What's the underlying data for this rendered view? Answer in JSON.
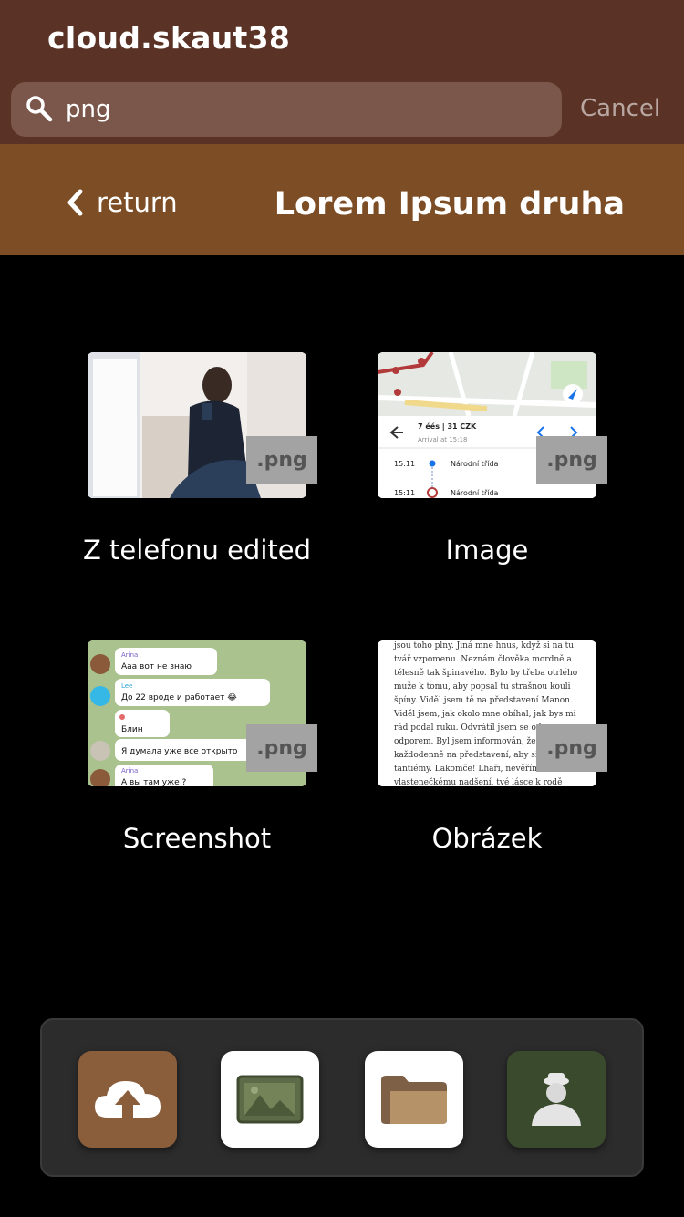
{
  "app": {
    "title": "cloud.skaut38"
  },
  "search": {
    "value": "png",
    "cancel_label": "Cancel"
  },
  "nav": {
    "back_label": "return",
    "folder_title": "Lorem Ipsum druha"
  },
  "files": [
    {
      "name": "Z telefonu edited",
      "ext": ".png"
    },
    {
      "name": "Image",
      "ext": ".png"
    },
    {
      "name": "Screenshot",
      "ext": ".png"
    },
    {
      "name": "Obrázek",
      "ext": ".png"
    }
  ],
  "thumb_text": {
    "map": {
      "line1": "7 éés | 31 CZK",
      "line2": "Arrival at 15:18",
      "stop_time_1": "15:11",
      "stop_name_1": "Národní třída",
      "stop_time_2": "15:11",
      "stop_name_2": "Národní třída"
    },
    "chat": [
      {
        "sender": "Arina",
        "text": "Ааа вот не знаю"
      },
      {
        "sender": "Lee",
        "text": "До 22 вроде и работает 😂"
      },
      {
        "sender": "",
        "text": "Блин"
      },
      {
        "sender": "",
        "text": "Я думала уже все открыто"
      },
      {
        "sender": "Arina",
        "text": "А вы там уже ?"
      }
    ],
    "doc": [
      "jsou toho plny. Jiná mne hnus, když si na tu",
      "tvář vzpomenu. Neznám člověka mordně a",
      "tělesně tak špinavého. Bylo by třeba otrlého",
      "muže k tomu, aby popsal tu strašnou kouli",
      "špíny. Viděl jsem tě na představení Manon.",
      "Viděl jsem, jak okolo mne obíhal, jak bys mi",
      "rád podal ruku. Odvrátil jsem se od",
      "odporem. Byl jsem informován, že",
      "každodenně na představení, aby si",
      "tantiémy. Lakomče! Lháři, nevěřím",
      "vlastenečkému nadšení, tvé lásce k rodě"
    ]
  },
  "dock": [
    {
      "icon": "cloud-upload-icon",
      "color": "#8a5d3b"
    },
    {
      "icon": "gallery-icon",
      "color": "#ffffff"
    },
    {
      "icon": "folder-icon",
      "color": "#ffffff"
    },
    {
      "icon": "user-icon",
      "color": "#3a4a2c"
    }
  ]
}
